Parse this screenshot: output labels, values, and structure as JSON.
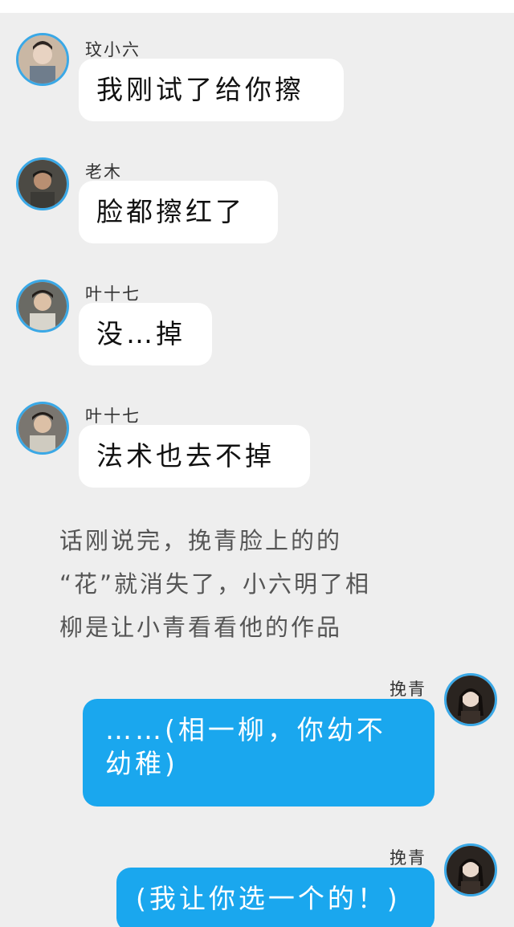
{
  "messages": [
    {
      "sender": "玟小六",
      "text": "我刚试了给你擦"
    },
    {
      "sender": "老木",
      "text": "脸都擦红了"
    },
    {
      "sender": "叶十七",
      "text": "没…掉"
    },
    {
      "sender": "叶十七",
      "text": "法术也去不掉"
    }
  ],
  "narration": {
    "line1": "话刚说完，挽青脸上的的",
    "line2": "“花”就消失了，小六明了相",
    "line3": "柳是让小青看看他的作品"
  },
  "outgoing": [
    {
      "sender": "挽青",
      "text": "……(相一柳，你幼不幼稚)"
    },
    {
      "sender": "挽青",
      "text": "(我让你选一个的！)"
    }
  ],
  "colors": {
    "background": "#eeeeee",
    "incoming_bubble": "#ffffff",
    "outgoing_bubble": "#1aa7ee",
    "avatar_ring": "#3aa8e6"
  }
}
